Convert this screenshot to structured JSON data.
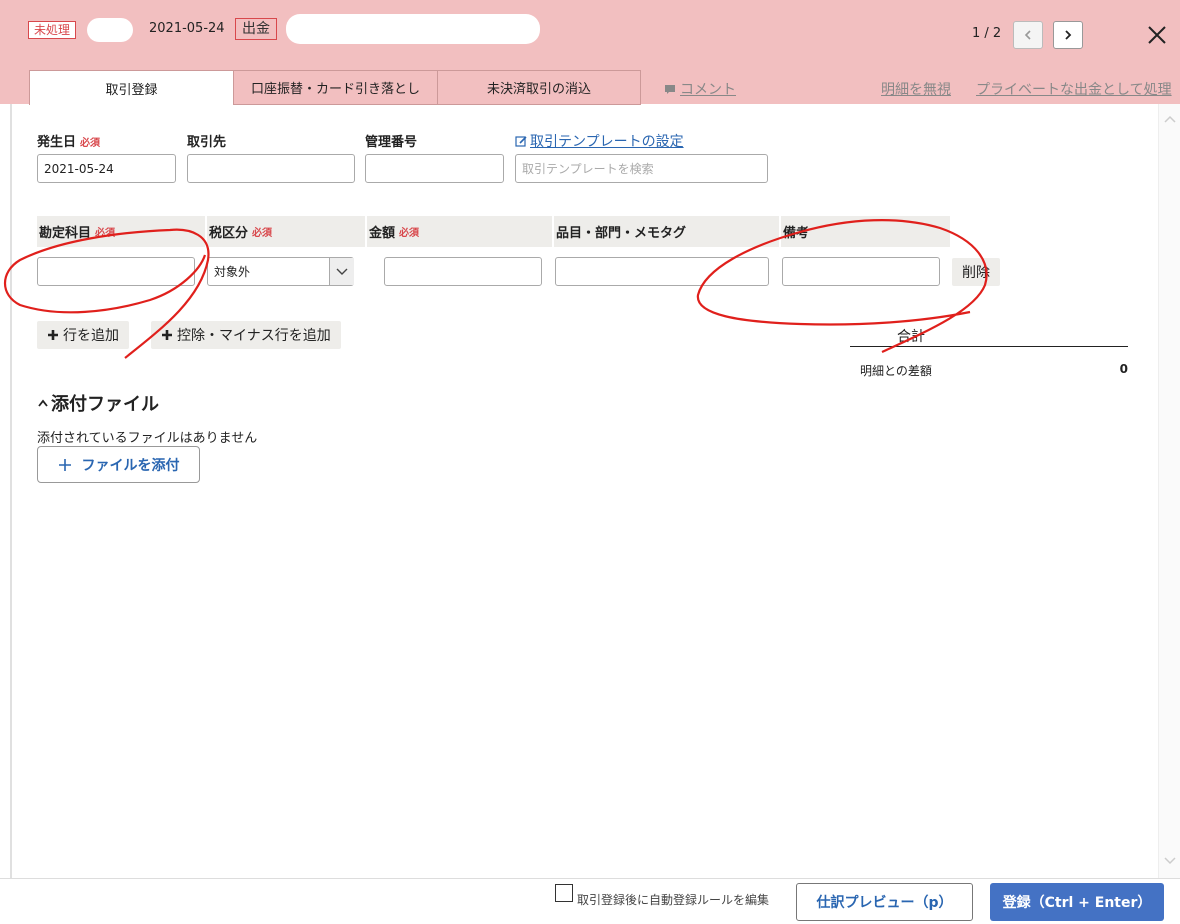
{
  "header": {
    "status_badge": "未処理",
    "date": "2021-05-24",
    "type_badge": "出金",
    "pager": "1 / 2"
  },
  "tabs": [
    {
      "label": "取引登録"
    },
    {
      "label": "口座振替・カード引き落とし"
    },
    {
      "label": "未決済取引の消込"
    }
  ],
  "header_links": {
    "comment": "コメント",
    "ignore": "明細を無視",
    "private": "プライベートな出金として処理"
  },
  "form": {
    "issue_date_label": "発生日",
    "required": "必須",
    "issue_date_value": "2021-05-24",
    "partner_label": "取引先",
    "manage_no_label": "管理番号",
    "template_link": "取引テンプレートの設定",
    "template_placeholder": "取引テンプレートを検索"
  },
  "table": {
    "headers": {
      "account": "勘定科目",
      "tax": "税区分",
      "amount": "金額",
      "item": "品目・部門・メモタグ",
      "memo": "備考"
    },
    "tax_value": "対象外",
    "delete": "削除",
    "add_row": "行を追加",
    "add_minus_row": "控除・マイナス行を追加",
    "total_label": "合計",
    "diff_label": "明細との差額",
    "diff_value": "0"
  },
  "attachments": {
    "title": "添付ファイル",
    "empty": "添付されているファイルはありません",
    "add_button": "ファイルを添付"
  },
  "footer": {
    "checkbox_label": "取引登録後に自動登録ルールを編集",
    "preview_button": "仕訳プレビュー（p）",
    "submit_button": "登録（Ctrl + Enter）"
  },
  "colors": {
    "header_bg": "#f2bfc0",
    "accent_red": "#d8484c",
    "primary_blue": "#4472c4",
    "link_blue": "#2a66b1",
    "annotation_red": "#e0201c"
  }
}
